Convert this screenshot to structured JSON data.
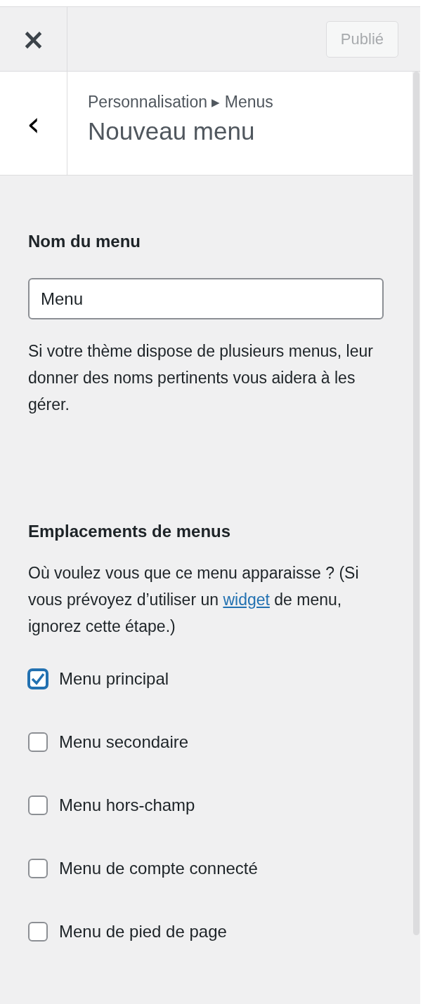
{
  "top_bar": {
    "close": "×",
    "publish_button": {
      "label": "Publié",
      "disabled": true
    }
  },
  "header": {
    "back": "‹",
    "breadcrumb": "Personnalisation ▸ Menus",
    "title": "Nouveau menu"
  },
  "menu_name": {
    "heading": "Nom du menu",
    "value": "Menu",
    "help": "Si votre thème dispose de plusieurs menus, leur donner des noms pertinents vous aidera à les gérer."
  },
  "locations": {
    "heading": "Emplacements de menus",
    "description_before": "Où voulez vous que ce menu apparaisse ? (Si vous prévoyez d’utiliser un ",
    "link": "widget",
    "description_after": " de menu, ignorez cette étape.)",
    "items": [
      {
        "label": "Menu principal",
        "checked": true
      },
      {
        "label": "Menu secondaire",
        "checked": false
      },
      {
        "label": "Menu hors-champ",
        "checked": false
      },
      {
        "label": "Menu de compte connecté",
        "checked": false
      },
      {
        "label": "Menu de pied de page",
        "checked": false
      }
    ]
  }
}
